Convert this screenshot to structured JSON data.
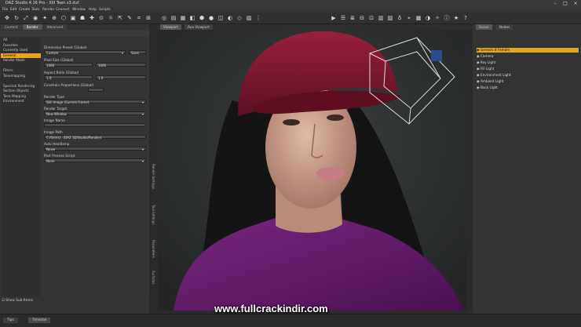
{
  "window": {
    "title": "DAZ Studio 4.16 Pro - XIII Teen s3.duf"
  },
  "menu": [
    "File",
    "Edit",
    "Create",
    "Tools",
    "Render",
    "Connect",
    "Window",
    "Help",
    "Scripts"
  ],
  "toolbar_icons": [
    "transform-icon",
    "rotate-icon",
    "scale-icon",
    "node-weight-icon",
    "joint-editor-icon",
    "surface-selection-icon",
    "geometry-editor-icon",
    "camera-icon",
    "render-icon",
    "light-icon",
    "pose-icon",
    "tab-icon"
  ],
  "left_panel": {
    "tabs": [
      "Content",
      "Render",
      "Advanced"
    ],
    "categories": [
      {
        "label": "All",
        "selected": false
      },
      {
        "label": "Favorites",
        "selected": false
      },
      {
        "label": "Currently Used",
        "selected": false
      },
      {
        "label": "General",
        "selected": true
      },
      {
        "label": "Render Mode",
        "selected": false
      },
      {
        "label": "",
        "selected": false
      },
      {
        "label": "Filters",
        "selected": false
      },
      {
        "label": "Tonemapping",
        "selected": false
      },
      {
        "label": "",
        "selected": false
      },
      {
        "label": "Spectral Rendering",
        "selected": false
      },
      {
        "label": "Section Objects",
        "selected": false
      },
      {
        "label": "Tone Mapping",
        "selected": false
      },
      {
        "label": "Environment",
        "selected": false
      }
    ],
    "props": {
      "preset_label": "Dimension Preset (Global)",
      "preset_value": "Custom",
      "save_label": "Save",
      "pixel_size_label": "Pixel Size (Global)",
      "pixel_w": "1080",
      "pixel_h": "1080",
      "aspect_label": "Aspect Ratio (Global)",
      "aspect_a": "1.0",
      "aspect_b": "1.0",
      "constrain_label": "Constrain Proportions (Global)",
      "render_type_label": "Render Type",
      "render_type_value": "Still Image (Current Frame)",
      "render_target_label": "Render Target",
      "render_target_value": "New Window",
      "image_name_label": "Image Name",
      "image_path_label": "Image Path",
      "image_path_value": "C:/Users/.../DAZ 3D/Studio/Renders",
      "postprocess_label": "Auto Headlamp",
      "postprocess_value": "Never",
      "post_script_label": "Post Process Script",
      "post_script_value": "None"
    },
    "vertical_tabs": [
      "Render Settings",
      "Tool Settings",
      "Parameters",
      "Surfaces"
    ],
    "show_subitems": "Show Sub-Items"
  },
  "viewport": {
    "tabs": [
      "Viewport",
      "Aux Viewport"
    ],
    "camera_label": "Camera"
  },
  "right_panel": {
    "tabs": [
      "Scene",
      "Nodes"
    ],
    "nodes": [
      {
        "label": "Genesis 8 Female",
        "selected": true
      },
      {
        "label": "Camera",
        "selected": false
      },
      {
        "label": "Key Light",
        "selected": false
      },
      {
        "label": "Fill Light",
        "selected": false
      },
      {
        "label": "Environment Light",
        "selected": false
      },
      {
        "label": "Ambient Light",
        "selected": false
      },
      {
        "label": "Back Light",
        "selected": false
      }
    ]
  },
  "bottom_tabs": [
    "Tips",
    "Timeline"
  ],
  "watermark": "www.fullcrackindir.com",
  "colors": {
    "accent": "#e7a51e",
    "cap": "#7a1630",
    "shirt": "#6a1a6e"
  }
}
